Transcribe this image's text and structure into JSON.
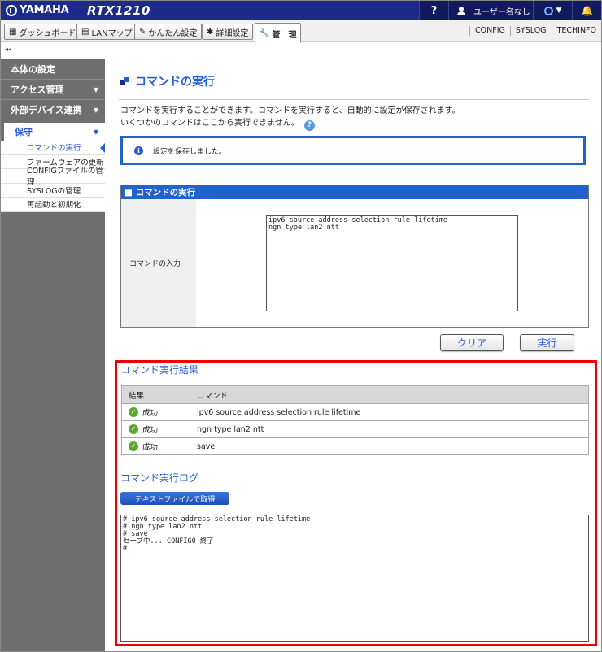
{
  "header": {
    "brand": "YAMAHA",
    "model": "RTX1210",
    "help_label": "?",
    "user_label": "ユーザー名なし",
    "bell_label": "🔔"
  },
  "nav": {
    "tabs": [
      {
        "label": "ダッシュボード",
        "icon": "dashboard-icon",
        "glyph": "▦"
      },
      {
        "label": "LANマップ",
        "icon": "lan-map-icon",
        "glyph": "▤"
      },
      {
        "label": "かんたん設定",
        "icon": "wizard-icon",
        "glyph": "✎"
      },
      {
        "label": "詳細設定",
        "icon": "gear-icon",
        "glyph": "✱"
      },
      {
        "label": "管　理",
        "icon": "wrench-icon",
        "glyph": "🔧"
      }
    ],
    "links": [
      "CONFIG",
      "SYSLOG",
      "TECHINFO"
    ]
  },
  "sidebar": {
    "collapse_glyph": "◂◂",
    "sections": [
      {
        "label": "本体の設定"
      },
      {
        "label": "アクセス管理"
      },
      {
        "label": "外部デバイス連携"
      }
    ],
    "open_section": "保守",
    "items": [
      {
        "label": "コマンドの実行"
      },
      {
        "label": "ファームウェアの更新"
      },
      {
        "label": "CONFIGファイルの管理"
      },
      {
        "label": "SYSLOGの管理"
      },
      {
        "label": "再起動と初期化"
      }
    ]
  },
  "main": {
    "title": "コマンドの実行",
    "desc_line1": "コマンドを実行することができます。コマンドを実行すると、自動的に設定が保存されます。",
    "desc_line2": "いくつかのコマンドはここから実行できません。",
    "notice": "設定を保存しました。",
    "panel_title": "■ コマンドの実行",
    "input_label": "コマンドの入力",
    "command_text": "ipv6 source address selection rule lifetime\nngn type lan2 ntt",
    "clear_label": "クリア",
    "run_label": "実行",
    "result_title": "コマンド実行結果",
    "result_headers": [
      "結果",
      "コマンド"
    ],
    "results": [
      {
        "status": "成功",
        "command": "ipv6 source address selection rule lifetime"
      },
      {
        "status": "成功",
        "command": "ngn type lan2 ntt"
      },
      {
        "status": "成功",
        "command": "save"
      }
    ],
    "log_title": "コマンド実行ログ",
    "download_label": "テキストファイルで取得",
    "log_text": "# ipv6 source address selection rule lifetime\n# ngn type lan2 ntt\n# save\nセーブ中... CONFIG0 終了\n#"
  },
  "colors": {
    "topbar": "#1c2a8c",
    "accent": "#2a5bd7",
    "highlight_frame": "#e00000",
    "success": "#5aa832"
  }
}
